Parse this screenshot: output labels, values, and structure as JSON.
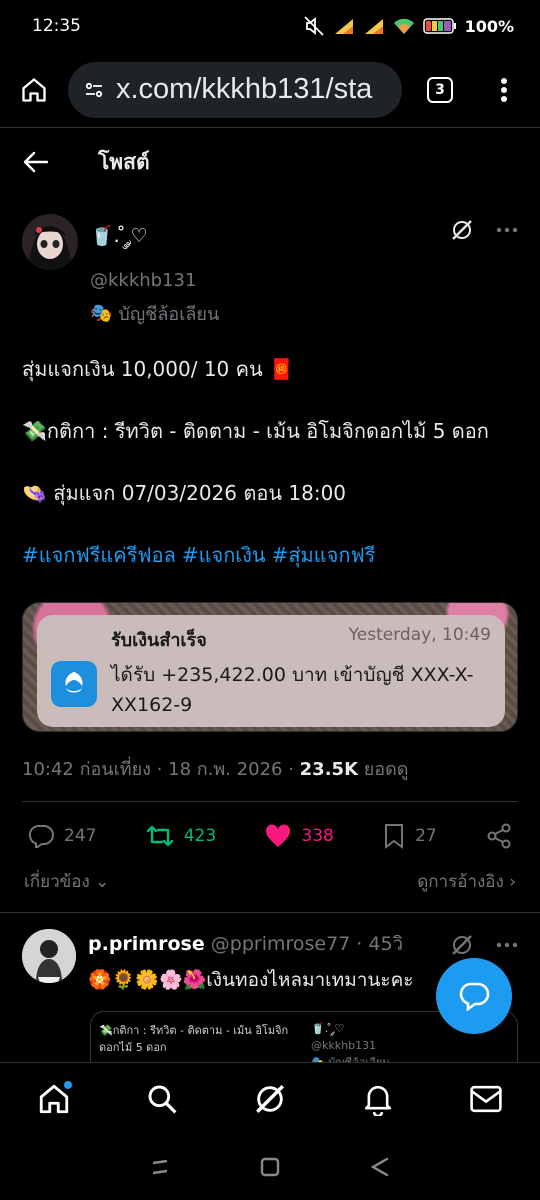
{
  "status_bar": {
    "time": "12:35",
    "battery": "100%"
  },
  "browser": {
    "url": "x.com/kkkhb131/sta",
    "tab_count": "3"
  },
  "header": {
    "title": "โพสต์"
  },
  "post": {
    "display_name": "🥤. ̊ ༘♡",
    "handle": "@kkkhb131",
    "parody_label": "บัญชีล้อเลียน",
    "text_line1": "สุ่มแจกเงิน 10,000/ 10  คน 🧧",
    "text_line2": "💸กติกา : รีทวิต - ติดตาม - เม้น อิโมจิกดอกไม้ 5 ดอก",
    "text_line3": "👒 สุ่มแจก 07/03/2026 ตอน 18:00",
    "hashtags": [
      "#แจกฟรีแค่รีฟอล",
      "#แจกเงิน",
      "#สุ่มแจกฟรี"
    ],
    "media": {
      "notif_title": "รับเงินสำเร็จ",
      "notif_time": "Yesterday, 10:49",
      "notif_message": "ได้รับ +235,422.00 บาท เข้าบัญชี XXX-X-XX162-9"
    },
    "timestamp": "10:42 ก่อนเที่ยง · 18 ก.พ. 2026 · ",
    "views_count": "23.5K",
    "views_label": " ยอดดู",
    "replies": "247",
    "reposts": "423",
    "likes": "338",
    "bookmarks": "27",
    "related_label": "เกี่ยวข้อง",
    "view_quotes_label": "ดูการอ้างอิง"
  },
  "reply": {
    "display_name": "p.primrose",
    "handle_time": " @pprimrose77 · 45วิ",
    "text": "🏵️🌻🌼🌸🌺เงินทองไหลมาเทมานะคะ",
    "quote_text": "💸กติกา : รีทวิต - ติดตาม - เม้น อิโมจิก ดอกไม้ 5 ดอก",
    "quote_name": "🥤. ̊ ༘♡",
    "quote_handle": "@kkkhb131",
    "quote_parody": "🎭 บัญชีล้อเลียน"
  },
  "colors": {
    "accent": "#1d9bf0",
    "repost": "#00ba7c",
    "like": "#f91880",
    "muted": "#71767b"
  }
}
